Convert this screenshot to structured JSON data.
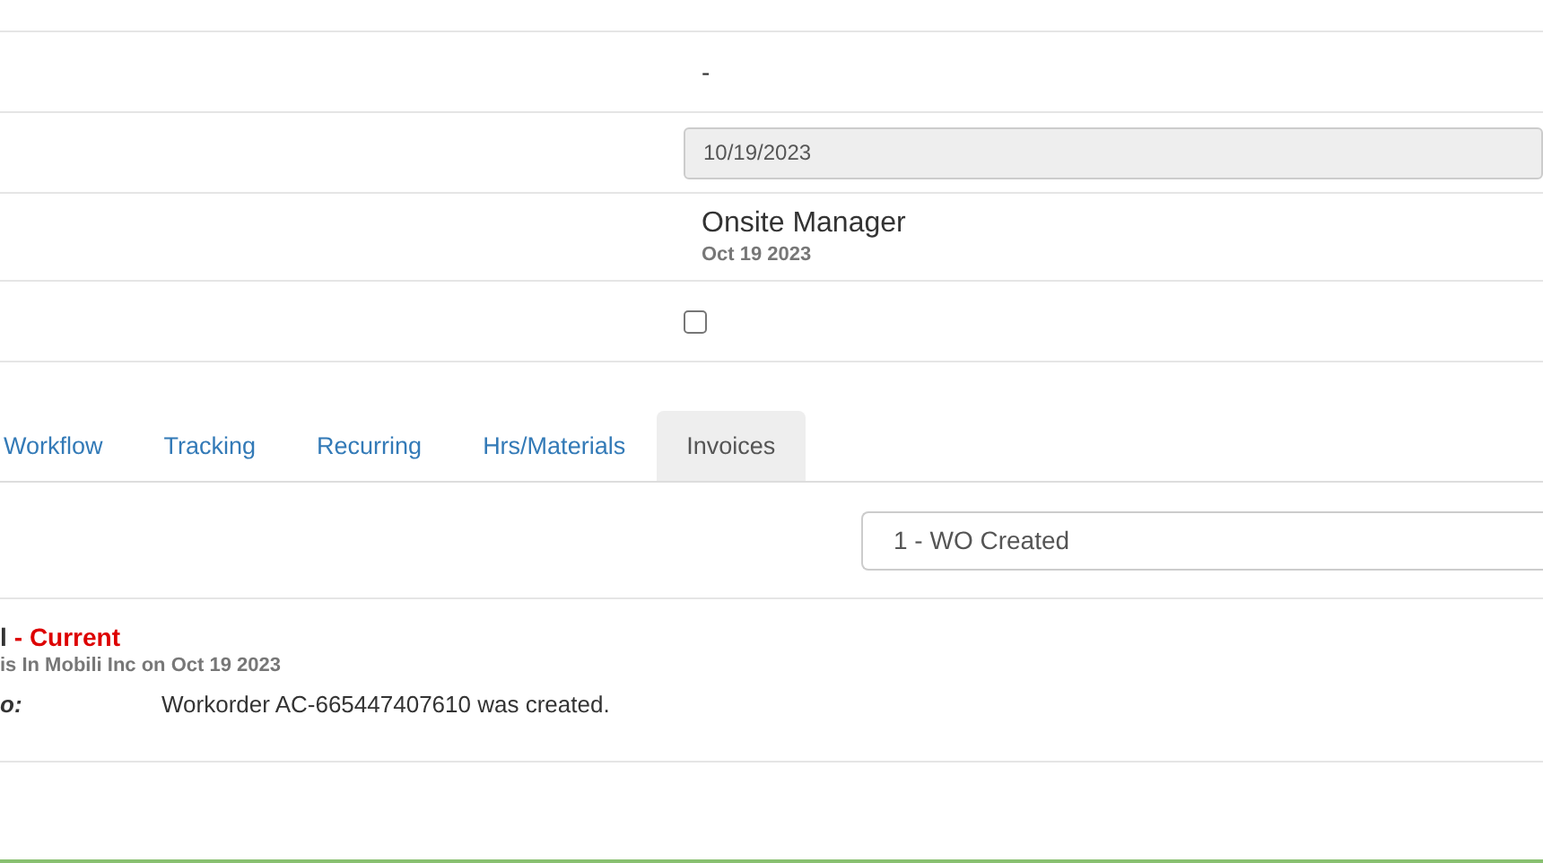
{
  "fields": [
    {
      "kind": "text",
      "value": "-"
    },
    {
      "kind": "date",
      "value": "10/19/2023"
    },
    {
      "kind": "person",
      "value": "Onsite Manager",
      "sub": "Oct 19 2023"
    },
    {
      "kind": "checkbox",
      "checked": false
    }
  ],
  "tabs": [
    {
      "label": "Workflow",
      "selected": false
    },
    {
      "label": "Tracking",
      "selected": false
    },
    {
      "label": "Recurring",
      "selected": false
    },
    {
      "label": "Hrs/Materials",
      "selected": false
    },
    {
      "label": "Invoices",
      "selected": true
    }
  ],
  "status_select": {
    "value": "1 - WO Created"
  },
  "history": [
    {
      "title": "l",
      "status": "- Current",
      "byline": "is In Mobili Inc on Oct 19 2023",
      "label": "o:",
      "note": "Workorder AC-665447407610 was created."
    }
  ]
}
